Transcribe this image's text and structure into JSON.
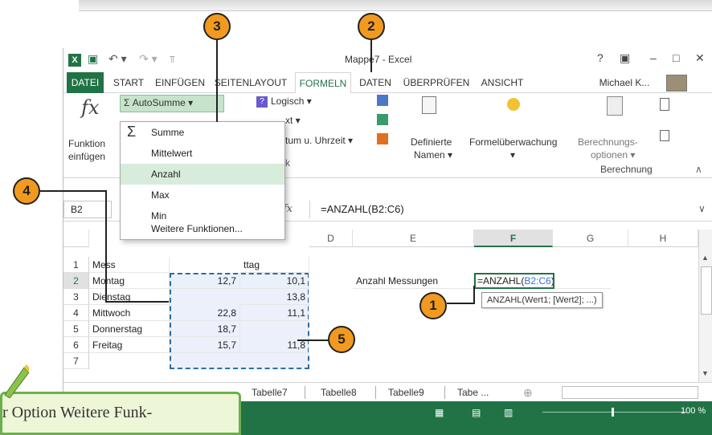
{
  "window": {
    "title": "Mappe7 - Excel",
    "logo": "X",
    "help": "?",
    "ribbon_display": "▣",
    "minimize": "–",
    "maximize": "□",
    "close": "✕"
  },
  "quick_access": {
    "save": "▣",
    "undo": "↶ ▾",
    "redo": "↷ ▾",
    "customize": "⫪"
  },
  "tabs": [
    "DATEI",
    "START",
    "EINFÜGEN",
    "SEITENLAYOUT",
    "FORMELN",
    "DATEN",
    "ÜBERPRÜFEN",
    "ANSICHT"
  ],
  "active_tab": "FORMELN",
  "user": "Michael K...",
  "ribbon": {
    "fx_symbol": "fx",
    "insert_function_line1": "Funktion",
    "insert_function_line2": "einfügen",
    "autosum": "Σ AutoSumme ▾",
    "logical": "Logisch ▾",
    "text_partial": "xt ▾",
    "datetime_partial": "tum u. Uhrzeit ▾",
    "defined_names_line1": "Definierte",
    "defined_names_line2": "Namen ▾",
    "formula_auditing": "Formelüberwachung",
    "formula_auditing_arrow": "▾",
    "calc_options_line1": "Berechnungs-",
    "calc_options_line2": "optionen ▾",
    "calc_group": "Berechnung",
    "collapse": "∧",
    "small_group_label": "k"
  },
  "formula_bar": {
    "name_box": "B2",
    "fx": "fx",
    "formula": "=ANZAHL(B2:C6)",
    "expand": "∨"
  },
  "columns": [
    "D",
    "E",
    "F",
    "G",
    "H"
  ],
  "rows": [
    "1",
    "2",
    "3",
    "4",
    "5",
    "6",
    "7"
  ],
  "cells": {
    "a1": "Mess",
    "c1": "ttag",
    "a2": "Montag",
    "b2": "12,7",
    "c2": "10,1",
    "e2": "Anzahl Messungen",
    "f2_prefix": "=ANZAHL(",
    "f2_ref": "B2:C6",
    "f2_suffix": ")",
    "a3": "Dienstag",
    "c3": "13,8",
    "a4": "Mittwoch",
    "b4": "22,8",
    "c4": "11,1",
    "a5": "Donnerstag",
    "b5": "18,7",
    "a6": "Freitag",
    "b6": "15,7",
    "c6": "11,8"
  },
  "tooltip": "ANZAHL(Wert1; [Wert2]; ...)",
  "dropdown": [
    "Summe",
    "Mittelwert",
    "Anzahl",
    "Max",
    "Min",
    "Weitere Funktionen..."
  ],
  "dropdown_sigma": "Σ",
  "sheets": [
    "Tabelle7",
    "Tabelle8",
    "Tabelle9",
    "Tabe ..."
  ],
  "sheet_add": "⊕",
  "zoom": "100 %",
  "callouts": [
    "1",
    "2",
    "3",
    "4",
    "5"
  ],
  "hint_text": "r Option Weitere Funk-",
  "colors": {
    "excel_green": "#217346",
    "callout_orange": "#f29a1f",
    "hint_bg": "#eef6d8"
  }
}
